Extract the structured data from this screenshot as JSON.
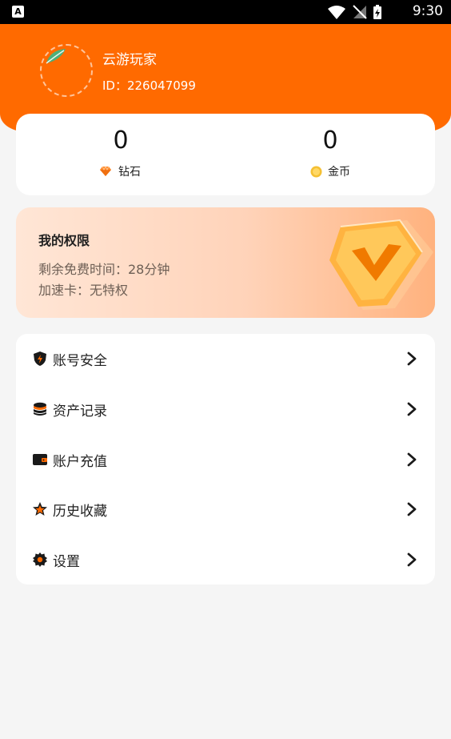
{
  "status_bar": {
    "time": "9:30",
    "app_letter": "A"
  },
  "profile": {
    "name": "云游玩家",
    "id_text": "ID：226047099"
  },
  "stats": [
    {
      "value": "0",
      "label": "钻石",
      "icon": "diamond-icon"
    },
    {
      "value": "0",
      "label": "金币",
      "icon": "coin-icon"
    }
  ],
  "permissions": {
    "title": "我的权限",
    "remaining_free_time": "剩余免费时间：28分钟",
    "speed_card": "加速卡：无特权",
    "badge_icon": "vip-v-badge-icon"
  },
  "menu": [
    {
      "label": "账号安全",
      "icon": "shield-icon"
    },
    {
      "label": "资产记录",
      "icon": "coin-stack-icon"
    },
    {
      "label": "账户充值",
      "icon": "wallet-icon"
    },
    {
      "label": "历史收藏",
      "icon": "star-icon"
    },
    {
      "label": "设置",
      "icon": "gear-icon"
    }
  ],
  "colors": {
    "brand_orange": "#ff6a00",
    "background": "#f5f5f5"
  }
}
